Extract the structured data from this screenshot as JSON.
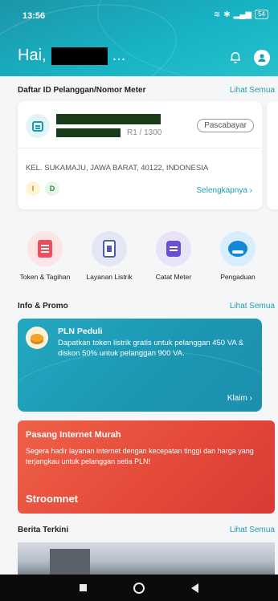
{
  "status_bar": {
    "time": "13:56",
    "battery": "54"
  },
  "header": {
    "greeting": "Hai,",
    "name_ellipsis": "..."
  },
  "meter_section": {
    "title": "Daftar ID Pelanggan/Nomor Meter",
    "see_all": "Lihat Semua"
  },
  "meter_card": {
    "tariff": "R1 / 1300",
    "type_badge": "Pascabayar",
    "address": "KEL. SUKAMAJU, JAWA BARAT, 40122, INDONESIA",
    "indicator_i": "I",
    "indicator_d": "D",
    "detail_link": "Selengkapnya ›"
  },
  "menu": [
    {
      "label": "Token & Tagihan",
      "icon": "token-bill-icon"
    },
    {
      "label": "Layanan Listrik",
      "icon": "electricity-service-icon"
    },
    {
      "label": "Catat Meter",
      "icon": "meter-record-icon"
    },
    {
      "label": "Pengaduan",
      "icon": "complaint-icon"
    }
  ],
  "info_section": {
    "title": "Info & Promo",
    "see_all": "Lihat Semua"
  },
  "promo1": {
    "title": "PLN Peduli",
    "text": "Dapatkan token listrik gratis untuk pelanggan 450 VA & diskon 50% untuk pelanggan 900 VA.",
    "cta": "Klaim ›"
  },
  "promo2": {
    "title": "Pasang Internet Murah",
    "text": "Segera hadir layanan internet dengan kecepatan tinggi dan harga yang terjangkau untuk pelanggan setia PLN!",
    "brand": "Stroomnet"
  },
  "news_section": {
    "title": "Berita Terkini",
    "see_all": "Lihat Semua"
  }
}
